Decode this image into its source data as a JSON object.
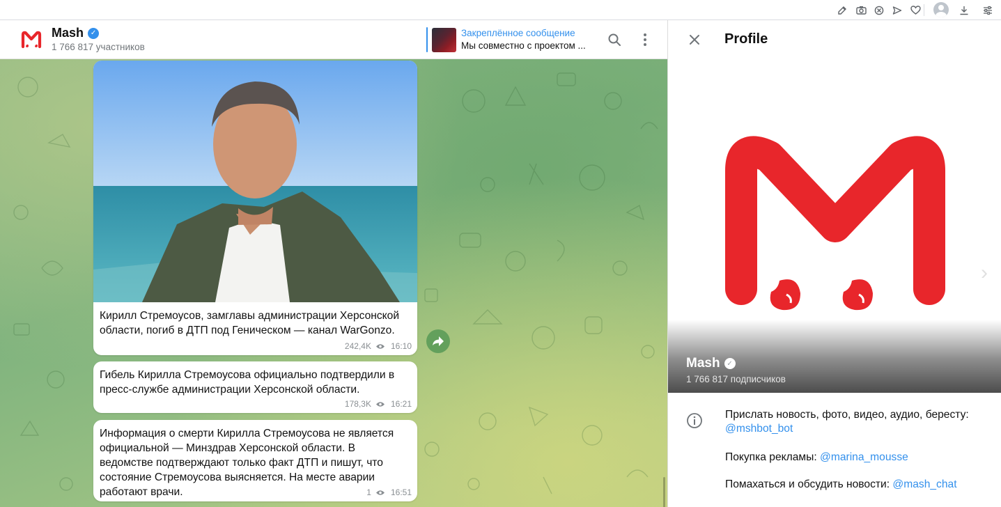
{
  "browser": {
    "toolbar_icons": [
      "edit-icon",
      "camera-icon",
      "block-icon",
      "send-icon",
      "heart-icon",
      "download-icon",
      "sliders-icon"
    ]
  },
  "chat": {
    "title": "Mash",
    "subtitle": "1 766 817 участников",
    "pinned_title": "Закреплённое сообщение",
    "pinned_text": "Мы совместно с проектом ...",
    "messages": [
      {
        "text": "Кирилл Стремоусов, замглавы администрации Херсонской области, погиб в ДТП под Геническом — канал WarGonzo.",
        "views": "242,4K",
        "time": "16:10",
        "has_photo": true
      },
      {
        "text": "Гибель Кирилла Стремоусова официально подтвердили в пресс-службе администрации Херсонской области.",
        "views": "178,3K",
        "time": "16:21"
      },
      {
        "text": "Информация о смерти Кирилла Стремоусова не является официальной — Минздрав Херсонской области. В ведомстве подтверждают только факт ДТП и пишут, что состояние Стремоусова выясняется. На месте аварии работают врачи.",
        "views": "1",
        "time": "16:51"
      }
    ]
  },
  "profile": {
    "header_title": "Profile",
    "name": "Mash",
    "subtitle": "1 766 817 подписчиков",
    "info": {
      "line1_text": "Прислать новость, фото, видео, аудио, бересту:",
      "line1_link": "@mshbot_bot",
      "line2_text": "Покупка рекламы:",
      "line2_link": "@marina_mousse",
      "line3_text": "Помахаться и обсудить новости:",
      "line3_link": "@mash_chat"
    }
  },
  "colors": {
    "accent": "#3390ec",
    "brand_red": "#e8262b",
    "share_green": "#63a05c"
  }
}
